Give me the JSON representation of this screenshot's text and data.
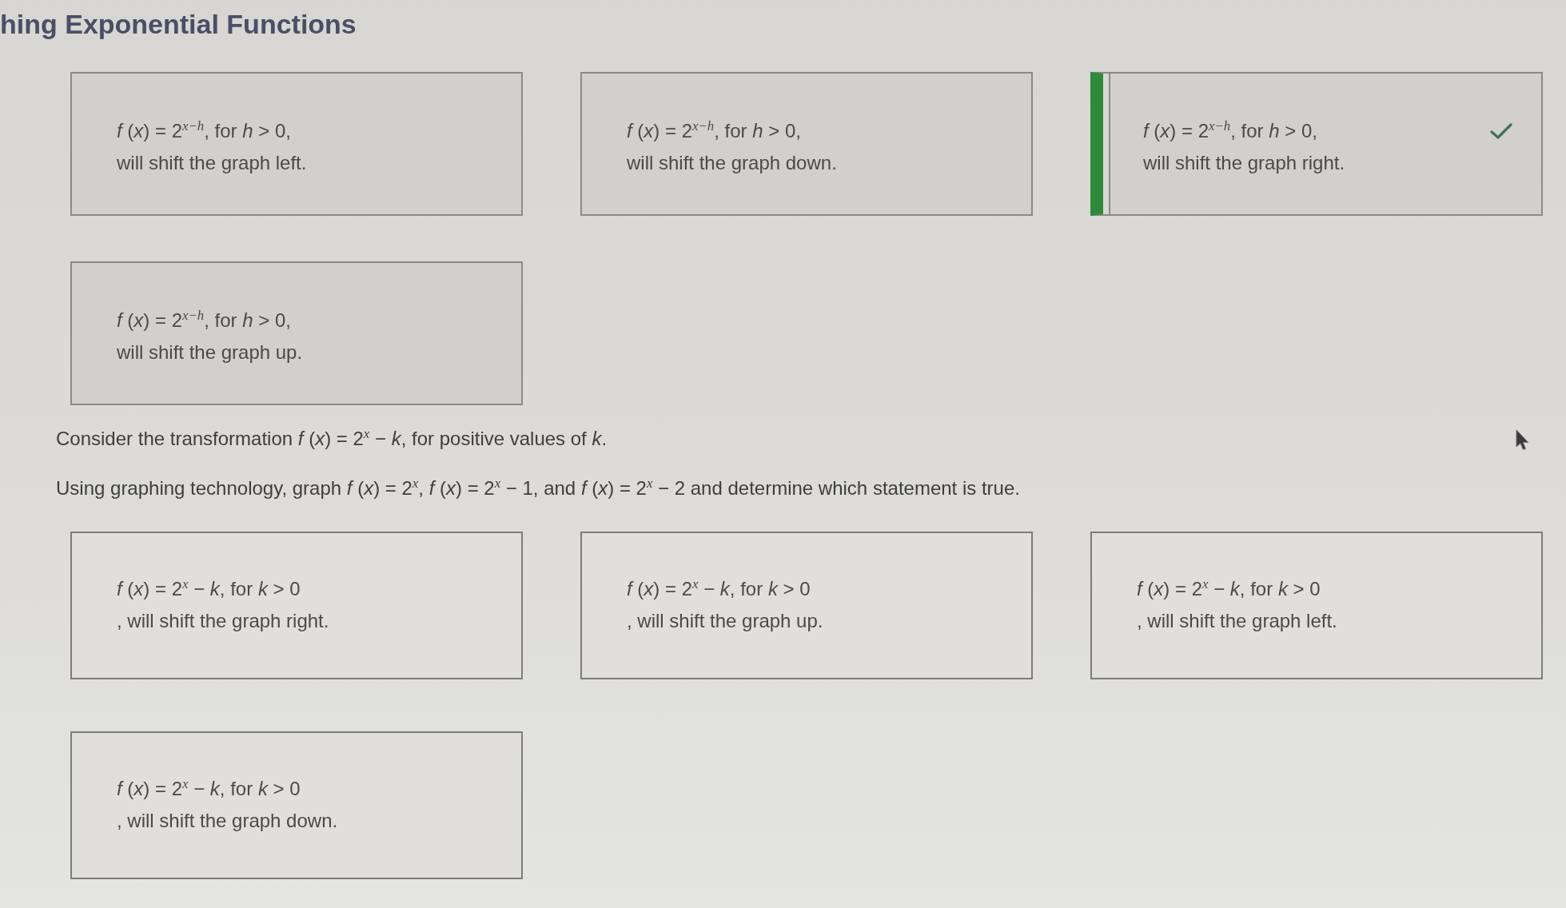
{
  "page": {
    "title": "hing Exponential Functions"
  },
  "answered_question": {
    "options": [
      {
        "formula": "*f* (*x*) = 2$^{x−h}$, for *h* > 0,",
        "statement": "will shift the graph left.",
        "selected": false,
        "correct": false
      },
      {
        "formula": "*f* (*x*) = 2$^{x−h}$, for *h* > 0,",
        "statement": "will shift the graph down.",
        "selected": false,
        "correct": false
      },
      {
        "formula": "*f* (*x*) = 2$^{x−h}$, for *h* > 0,",
        "statement": "will shift the graph right.",
        "selected": true,
        "correct": true
      },
      {
        "formula": "*f* (*x*) = 2$^{x−h}$, for *h* > 0,",
        "statement": "will shift the graph up.",
        "selected": false,
        "correct": false
      }
    ]
  },
  "question": {
    "prompt": [
      "Consider the transformation *f* (*x*) = 2$^{x}$ − *k*, for positive values of *k*.",
      "Using graphing technology, graph *f* (*x*) = 2$^{x}$, *f* (*x*) = 2$^{x}$ − 1, and *f* (*x*) = 2$^{x}$ − 2 and determine which statement is true."
    ],
    "options": [
      {
        "formula": "*f* (*x*) = 2$^{x}$ − *k*, for *k* > 0",
        "statement": ", will shift the graph right.",
        "selected": false,
        "correct": false
      },
      {
        "formula": "*f* (*x*) = 2$^{x}$ − *k*, for *k* > 0",
        "statement": ", will shift the graph up.",
        "selected": false,
        "correct": false
      },
      {
        "formula": "*f* (*x*) = 2$^{x}$ − *k*, for *k* > 0",
        "statement": ", will shift the graph left.",
        "selected": false,
        "correct": false
      },
      {
        "formula": "*f* (*x*) = 2$^{x}$ − *k*, for *k* > 0",
        "statement": ", will shift the graph down.",
        "selected": false,
        "correct": false
      }
    ]
  }
}
